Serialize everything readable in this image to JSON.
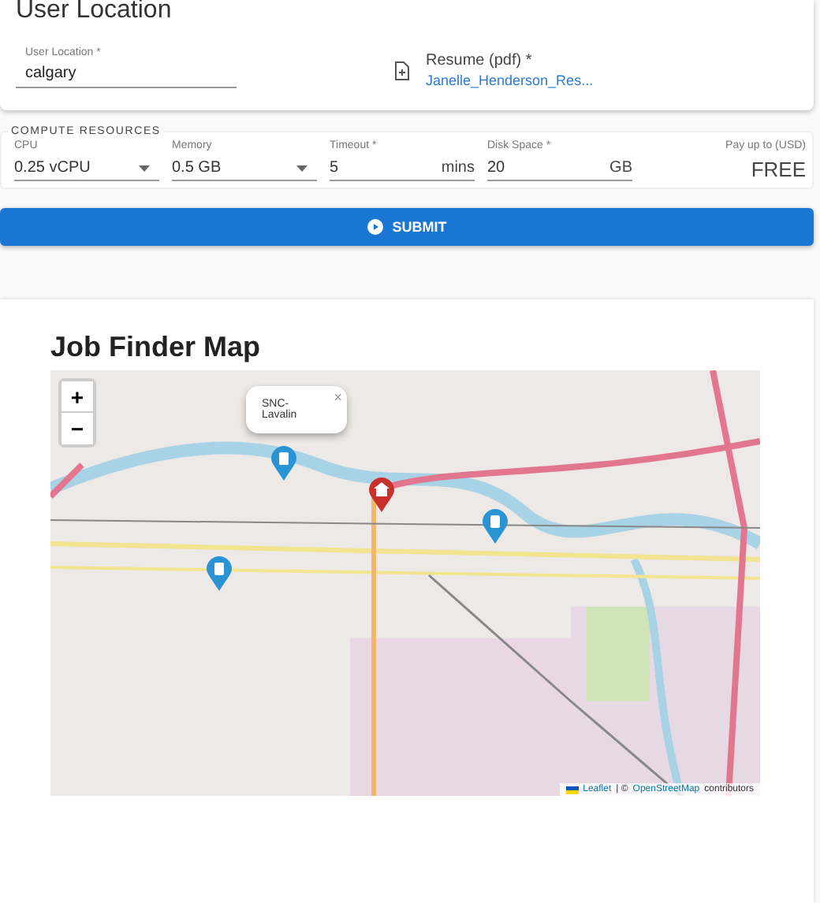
{
  "location_card": {
    "title": "User Location",
    "location_field": {
      "label": "User Location *",
      "value": "calgary"
    },
    "resume": {
      "label": "Resume (pdf) *",
      "file": "Janelle_Henderson_Res..."
    }
  },
  "compute": {
    "legend": "COMPUTE RESOURCES",
    "fields": [
      {
        "kind": "select",
        "label": "CPU",
        "value": "0.25 vCPU"
      },
      {
        "kind": "select",
        "label": "Memory",
        "value": "0.5 GB"
      },
      {
        "kind": "unit",
        "label": "Timeout *",
        "value": "5",
        "unit": "mins"
      },
      {
        "kind": "unit",
        "label": "Disk Space *",
        "value": "20",
        "unit": "GB"
      }
    ],
    "pay": {
      "label": "Pay up to (USD)",
      "value": "FREE"
    }
  },
  "submit": {
    "label": "SUBMIT"
  },
  "map_card": {
    "title": "Job Finder Map",
    "zoom": [
      "+",
      "−"
    ],
    "markers": [
      {
        "kind": "job"
      },
      {
        "kind": "home"
      },
      {
        "kind": "job"
      },
      {
        "kind": "job"
      }
    ],
    "popup": {
      "text": "SNC-Lavalin",
      "close": "×"
    },
    "attribution": {
      "leaflet": "Leaflet",
      "separator": "| ©",
      "osm": "OpenStreetMap",
      "suffix": "contributors"
    }
  }
}
